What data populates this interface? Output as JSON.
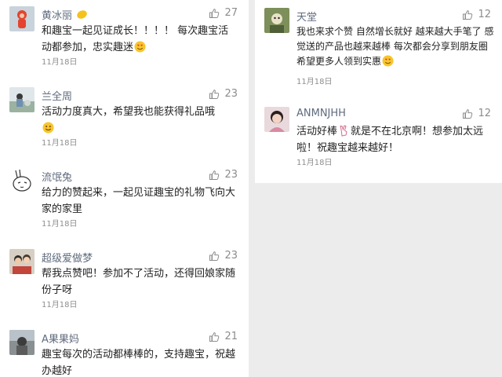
{
  "left_comments": [
    {
      "name": "黄冰丽",
      "likes": "27",
      "text_before_emoji": "和趣宝一起见证成长！！！！ 每次趣宝活动都参加，忠实趣迷",
      "emoji_name": "heart-eyes",
      "date": "11月18日"
    },
    {
      "name": "兰全周",
      "likes": "23",
      "text_before_emoji": "活动力度真大，希望我也能获得礼品哦",
      "emoji_name": "smile",
      "date": "11月18日"
    },
    {
      "name": "流氓兔",
      "likes": "23",
      "text": "给力的赞起来，一起见证趣宝的礼物飞向大家的家里",
      "date": "11月18日"
    },
    {
      "name": "超级爱做梦",
      "likes": "23",
      "text": "帮我点赞吧！参加不了活动，还得回娘家随份子呀",
      "date": "11月18日"
    },
    {
      "name": "A果果妈",
      "likes": "21",
      "text": "趣宝每次的活动都棒棒的，支持趣宝，祝越办越好"
    }
  ],
  "right_comments": [
    {
      "name": "天堂",
      "likes": "12",
      "text_before_emoji": "我也来求个赞 自然增长就好 越来越大手笔了 感觉送的产品也越来越棒 每次都会分享到朋友圈 希望更多人领到实惠",
      "emoji_name": "heart-eyes",
      "date": "11月18日"
    },
    {
      "name": "ANMNJHH",
      "likes": "12",
      "text_before_emoji": "活动好棒",
      "emoji_name": "victory-hand",
      "text_after_emoji": "就是不在北京啊！想参加太远啦！祝趣宝越来越好！",
      "date": "11月18日"
    }
  ],
  "colors": {
    "name": "#5f6b7e",
    "text": "#222222",
    "meta": "#8c8c8c",
    "panel": "#ffffff",
    "background": "#ececec"
  }
}
